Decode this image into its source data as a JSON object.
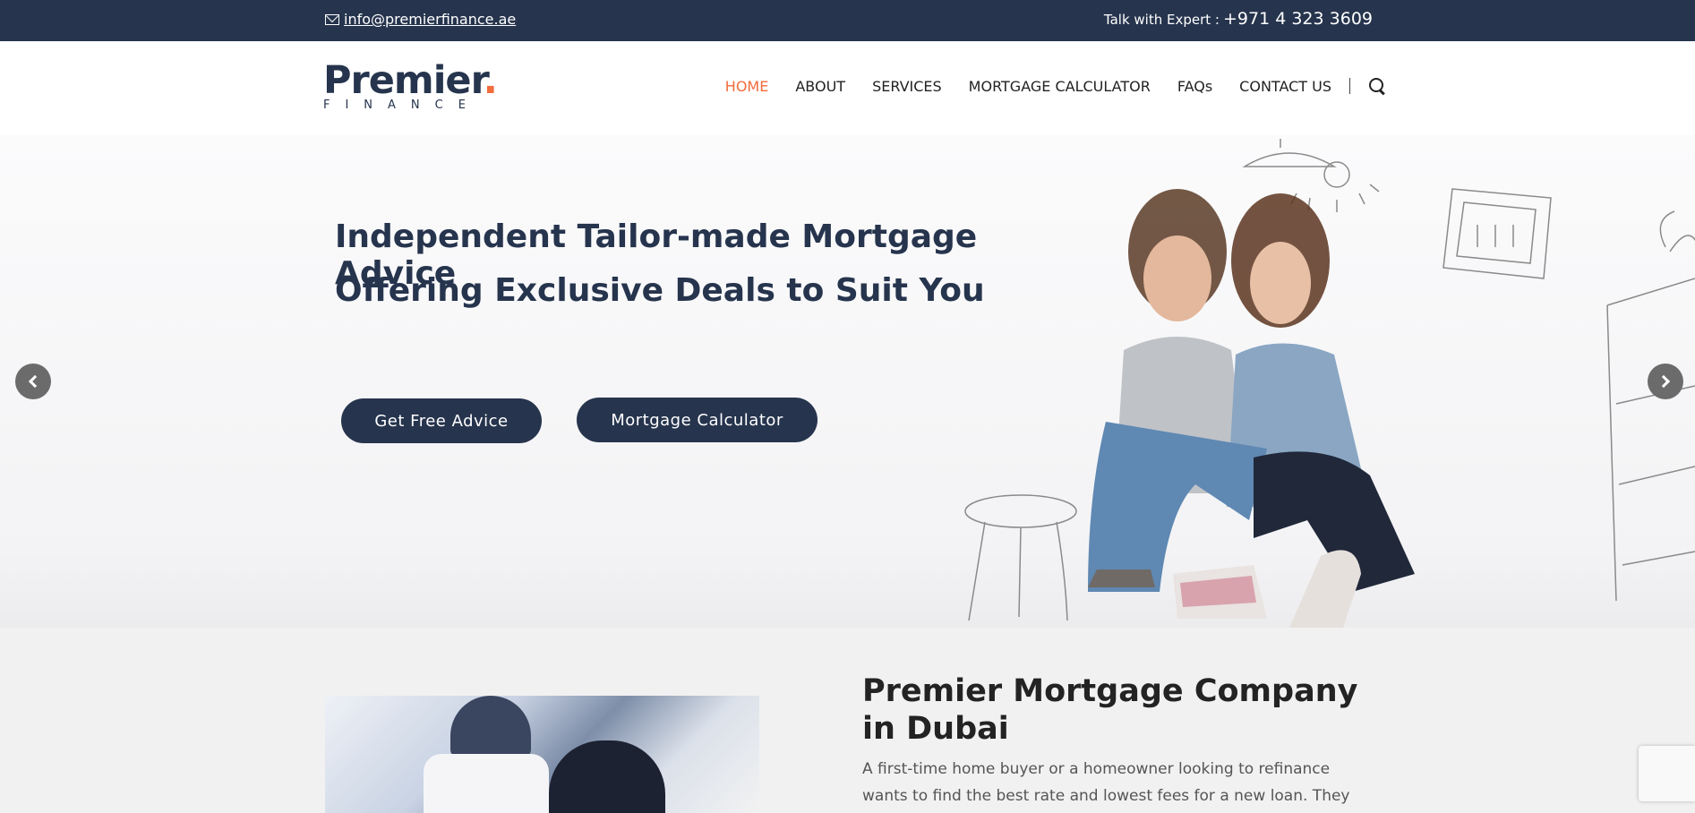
{
  "topbar": {
    "email": "info@premierfinance.ae",
    "phone_label": "Talk with Expert :",
    "phone_number": "+971 4 323 3609"
  },
  "logo": {
    "word": "Premier",
    "dot": ".",
    "sub": "FINANCE"
  },
  "nav": {
    "items": [
      {
        "label": "HOME",
        "active": true
      },
      {
        "label": "ABOUT"
      },
      {
        "label": "SERVICES"
      },
      {
        "label": "MORTGAGE CALCULATOR"
      },
      {
        "label": "FAQs"
      },
      {
        "label": "CONTACT US"
      }
    ],
    "search_icon": "search-icon"
  },
  "hero": {
    "line1": "Independent Tailor-made Mortgage Advice",
    "line2": "Offering Exclusive Deals to Suit You",
    "btn_advice": "Get Free Advice",
    "btn_calc": "Mortgage Calculator"
  },
  "about": {
    "title": "Premier Mortgage Company in Dubai",
    "text": "A first-time home buyer or a homeowner looking to refinance wants to find the best rate and lowest fees for a new loan. They compare"
  },
  "colors": {
    "navy": "#26344d",
    "accent": "#f26c3d",
    "section_bg": "#f1f1f1"
  }
}
